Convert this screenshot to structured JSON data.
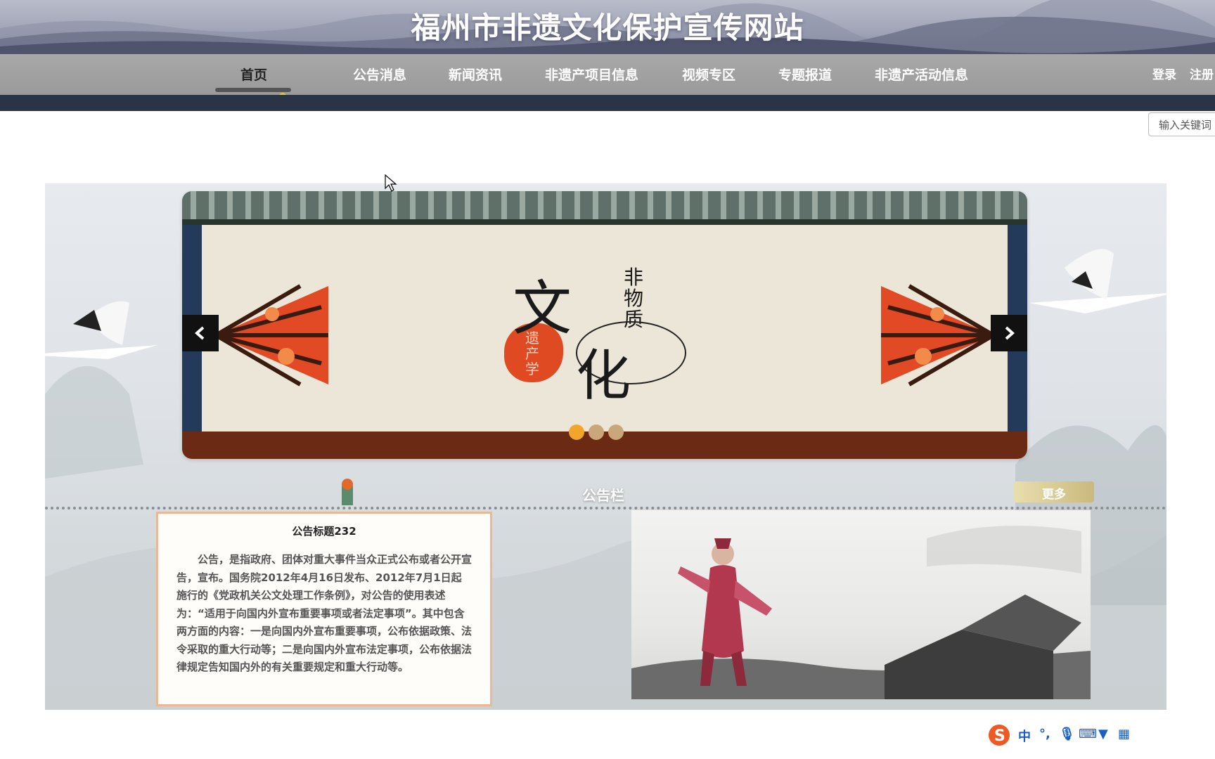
{
  "header": {
    "site_title": "福州市非遗文化保护宣传网站"
  },
  "nav": {
    "items": [
      {
        "label": "首页",
        "active": true
      },
      {
        "label": "公告消息"
      },
      {
        "label": "新闻资讯"
      },
      {
        "label": "非遗产项目信息"
      },
      {
        "label": "视频专区"
      },
      {
        "label": "专题报道"
      },
      {
        "label": "非遗产活动信息"
      }
    ],
    "login": "登录",
    "register": "注册"
  },
  "search": {
    "placeholder": "输入关键词"
  },
  "carousel": {
    "banner_text": {
      "wen": "文",
      "fei_wu_zhi": "非物质",
      "hua": "化",
      "seal": "遗产学"
    },
    "slide_count": 3,
    "active_index": 0
  },
  "notice_board": {
    "title": "公告栏",
    "more": "更多",
    "card": {
      "title": "公告标题232",
      "body": "公告，是指政府、团体对重大事件当众正式公布或者公开宣告，宣布。国务院2012年4月16日发布、2012年7月1日起施行的《党政机关公文处理工作条例》，对公告的使用表述为：“适用于向国内外宣布重要事项或者法定事项”。其中包含两方面的内容：一是向国内外宣布重要事项，公布依据政策、法令采取的重大行动等；二是向国内外宣布法定事项，公布依据法律规定告知国内外的有关重要规定和重大行动等。"
    }
  },
  "ime_toolbar": {
    "logo": "S",
    "mode": "中"
  },
  "colors": {
    "nav_bg": "#9a9a9a",
    "nav_under": "#2b3447",
    "dot_active": "#f1a62b",
    "card_border": "#e9b896",
    "banner_bottom": "#6b2a14"
  }
}
